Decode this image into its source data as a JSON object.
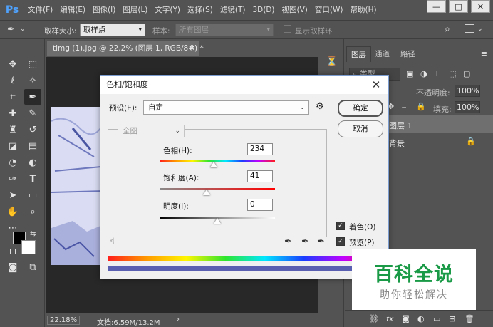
{
  "app": {
    "logo": "Ps"
  },
  "menu": [
    "文件(F)",
    "编辑(E)",
    "图像(I)",
    "图层(L)",
    "文字(Y)",
    "选择(S)",
    "滤镜(T)",
    "3D(D)",
    "视图(V)",
    "窗口(W)",
    "帮助(H)"
  ],
  "window_controls": {
    "minimize": "—",
    "restore": "□",
    "close": "✕"
  },
  "options": {
    "sample_size_label": "取样大小:",
    "sample_size_value": "取样点",
    "sample_label": "样本:",
    "sample_value": "所有图层",
    "show_ring_label": "显示取样环"
  },
  "document": {
    "tab_title": "timg (1).jpg @ 22.2% (图层 1, RGB/8#) *",
    "zoom": "22.18%",
    "doc_size": "文档:6.59M/13.2M"
  },
  "layers_panel": {
    "tabs": [
      "图层",
      "通道",
      "路径"
    ],
    "kind_label": "类型",
    "opacity_label": "不透明度:",
    "opacity_value": "100%",
    "fill_label": "填充:",
    "fill_value": "100%",
    "layers": [
      "图层 1",
      "背景"
    ]
  },
  "dialog": {
    "title": "色相/饱和度",
    "preset_label": "预设(E):",
    "preset_value": "自定",
    "channel_value": "全图",
    "ok_label": "确定",
    "cancel_label": "取消",
    "hue_label": "色相(H):",
    "hue_value": "234",
    "saturation_label": "饱和度(A):",
    "saturation_value": "41",
    "lightness_label": "明度(I):",
    "lightness_value": "0",
    "colorize_label": "着色(O)",
    "preview_label": "预览(P)",
    "colorize_checked": true,
    "preview_checked": true,
    "hue_position": 0.47,
    "saturation_position": 0.41,
    "lightness_position": 0.5
  },
  "watermark": {
    "title": "百科全说",
    "subtitle": "助你轻松解决"
  },
  "colors": {
    "ps_blue": "#4fa3ff",
    "watermark_green": "#1a9a46",
    "dialog_bg": "#f0f0f0"
  }
}
